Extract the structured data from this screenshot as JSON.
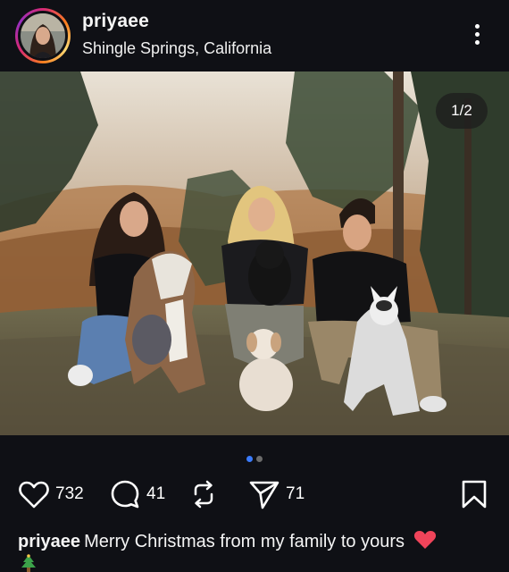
{
  "post": {
    "username": "priyaee",
    "location": "Shingle Springs, California",
    "image_counter": "1/2",
    "pagination": {
      "total": 2,
      "active": 0,
      "active_color": "#3a7bfd",
      "inactive_color": "#6b6b6b"
    }
  },
  "actions": {
    "likes": "732",
    "comments": "41",
    "shares": "71"
  },
  "caption": {
    "username": "priyaee",
    "text": "Merry Christmas from my family to yours"
  },
  "icons": {
    "more": "more-vertical-icon",
    "like": "heart-icon",
    "comment": "comment-icon",
    "repost": "repost-icon",
    "share": "send-icon",
    "save": "bookmark-icon",
    "caption_emoji_1": "red-heart-emoji",
    "caption_emoji_2": "christmas-tree-emoji"
  },
  "colors": {
    "background": "#0f1015",
    "text": "#ffffff",
    "heart_emoji": "#f0445a"
  }
}
